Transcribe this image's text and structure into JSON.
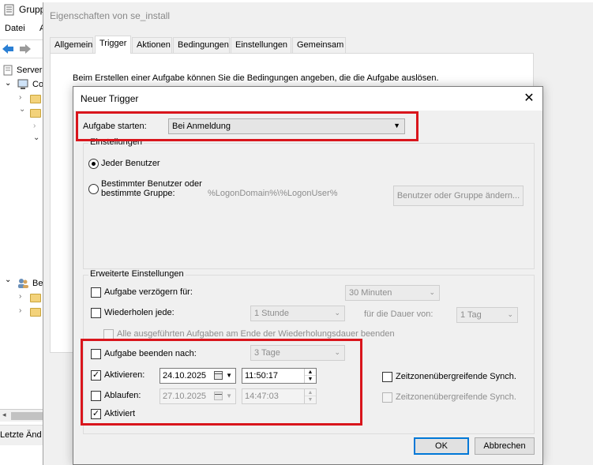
{
  "mmc": {
    "title": "Grupp",
    "menu": [
      "Datei",
      "A"
    ],
    "tree": [
      {
        "label": "Server"
      },
      {
        "label": "Co"
      },
      {
        "label": "Be"
      }
    ],
    "status": "Letzte Änd"
  },
  "props": {
    "title": "Eigenschaften von se_install",
    "tabs": [
      "Allgemein",
      "Trigger",
      "Aktionen",
      "Bedingungen",
      "Einstellungen",
      "Gemeinsam"
    ],
    "active_tab": "Trigger",
    "intro": "Beim Erstellen einer Aufgabe können Sie die Bedingungen angeben, die die Aufgabe auslösen."
  },
  "dialog": {
    "title": "Neuer Trigger",
    "start_label": "Aufgabe starten:",
    "start_value": "Bei Anmeldung",
    "settings_group": "Einstellungen",
    "radio_all": "Jeder Benutzer",
    "radio_specific_line1": "Bestimmter Benutzer oder",
    "radio_specific_line2": "bestimmte Gruppe:",
    "user_value": "%LogonDomain%\\%LogonUser%",
    "change_user_button": "Benutzer oder Gruppe ändern...",
    "advanced_group": "Erweiterte Einstellungen",
    "delay_label": "Aufgabe verzögern für:",
    "delay_value": "30 Minuten",
    "repeat_label": "Wiederholen jede:",
    "repeat_value": "1 Stunde",
    "duration_label": "für die Dauer von:",
    "duration_value": "1 Tag",
    "stop_all_label": "Alle ausgeführten Aufgaben am Ende der Wiederholungsdauer beenden",
    "stop_after_label": "Aufgabe beenden nach:",
    "stop_after_value": "3 Tage",
    "activate_label": "Aktivieren:",
    "activate_date": "24.10.2025",
    "activate_time": "11:50:17",
    "sync_label": "Zeitzonenübergreifende Synch.",
    "expire_label": "Ablaufen:",
    "expire_date": "27.10.2025",
    "expire_time": "14:47:03",
    "sync2_label": "Zeitzonenübergreifende Synch.",
    "enabled_label": "Aktiviert",
    "ok_button": "OK",
    "cancel_button": "Abbrechen"
  },
  "highlight_color": "#d9151c"
}
